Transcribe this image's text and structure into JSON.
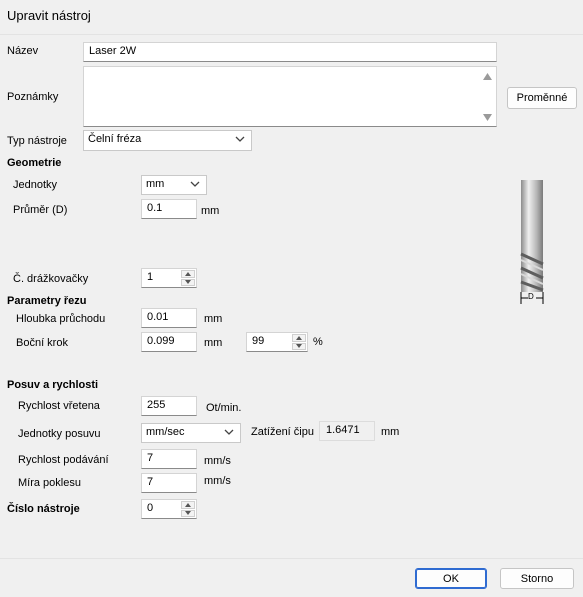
{
  "dialog": {
    "title": "Upravit nástroj"
  },
  "name": {
    "label": "Název",
    "value": "Laser 2W"
  },
  "notes": {
    "label": "Poznámky",
    "value": "",
    "variables_button": "Proměnné"
  },
  "tool_type": {
    "label": "Typ nástroje",
    "value": "Čelní fréza"
  },
  "geometry": {
    "heading": "Geometrie",
    "units_label": "Jednotky",
    "units_value": "mm",
    "diameter_label": "Průměr (D)",
    "diameter_value": "0.1",
    "diameter_unit": "mm",
    "flutes_label": "Č. drážkovačky",
    "flutes_value": "1",
    "diagram_label": "D"
  },
  "cut_params": {
    "heading": "Parametry řezu",
    "depth_label": "Hloubka průchodu",
    "depth_value": "0.01",
    "depth_unit": "mm",
    "stepover_label": "Boční krok",
    "stepover_value": "0.099",
    "stepover_unit": "mm",
    "stepover_percent": "99",
    "percent_unit": "%"
  },
  "feeds": {
    "heading": "Posuv a rychlosti",
    "spindle_label": "Rychlost vřetena",
    "spindle_value": "255",
    "spindle_unit": "Ot/min.",
    "feed_units_label": "Jednotky posuvu",
    "feed_units_value": "mm/sec",
    "chip_load_label": "Zatížení čipu",
    "chip_load_value": "1.6471",
    "chip_load_unit": "mm",
    "feed_rate_label": "Rychlost podávání",
    "feed_rate_value": "7",
    "feed_rate_unit": "mm/s",
    "plunge_label": "Míra poklesu",
    "plunge_value": "7",
    "plunge_unit": "mm/s"
  },
  "tool_number": {
    "label": "Číslo nástroje",
    "value": "0"
  },
  "footer": {
    "ok": "OK",
    "cancel": "Storno"
  },
  "icons": [
    "chevron-down-icon",
    "spin-up-icon",
    "spin-down-icon",
    "scroll-up-icon",
    "scroll-down-icon",
    "end-mill-icon"
  ]
}
